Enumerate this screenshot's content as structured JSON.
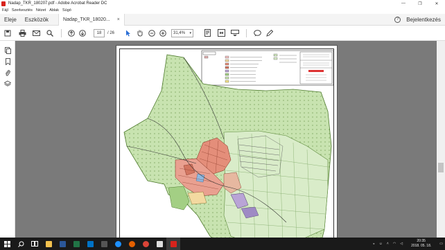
{
  "window": {
    "title": "Nadap_TKR_180207.pdf - Adobe Acrobat Reader DC",
    "minimize": "—",
    "maximize": "❐",
    "close": "✕"
  },
  "menu": [
    "Fájl",
    "Szerkesztés",
    "Nézet",
    "Ablak",
    "Súgó"
  ],
  "nav": {
    "home": "Eleje",
    "tools": "Eszközök",
    "doc_tab": "Nadap_TKR_18020...",
    "doc_tab_close": "×",
    "help": "?",
    "signin": "Bejelentkezés"
  },
  "toolbar": {
    "page_current": "18",
    "page_total": "/ 26",
    "zoom": "31,4%"
  },
  "taskbar": {
    "time": "20:35",
    "date": "2018. 05. 18."
  },
  "colors": {
    "viewer_bg": "#7a7a7a",
    "map_green": "#c8e3b0",
    "map_dark_green": "#a3cf84",
    "residential": "#e48e7a",
    "purple": "#b9a4d6",
    "taskbar": "#1a1a1a"
  }
}
